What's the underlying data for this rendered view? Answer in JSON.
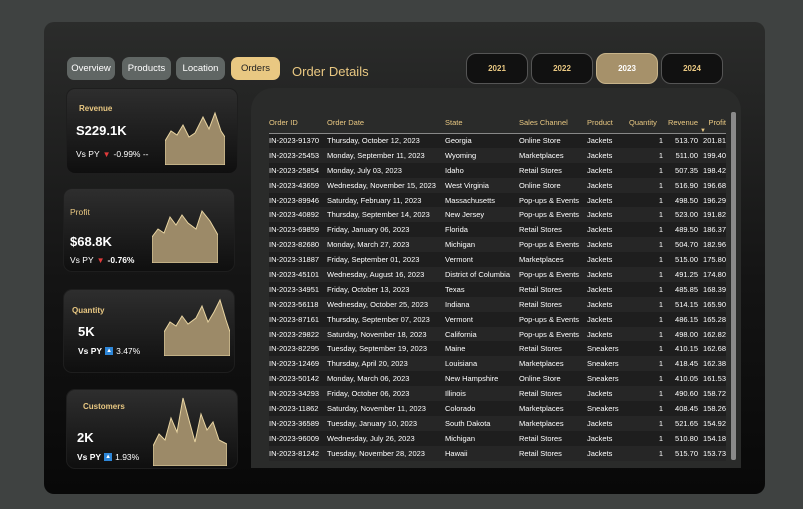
{
  "nav": {
    "tabs": [
      {
        "label": "Overview",
        "active": false
      },
      {
        "label": "Products",
        "active": false
      },
      {
        "label": "Location",
        "active": false
      },
      {
        "label": "Orders",
        "active": true
      }
    ]
  },
  "section_title": "Order Details",
  "years": [
    {
      "label": "2021",
      "active": false
    },
    {
      "label": "2022",
      "active": false
    },
    {
      "label": "2023",
      "active": true
    },
    {
      "label": "2024",
      "active": false
    }
  ],
  "kpis": {
    "revenue": {
      "label": "Revenue",
      "value": "S229.1K",
      "vs_label": "Vs PY",
      "change": "-0.99% --",
      "trend": "down"
    },
    "profit": {
      "label": "Profit",
      "value": "$68.8K",
      "vs_label": "Vs PY",
      "change": "-0.76%",
      "trend": "down"
    },
    "quantity": {
      "label": "Quantity",
      "value": "5K",
      "vs_label": "Vs PY",
      "change": "3.47%",
      "trend": "up"
    },
    "customers": {
      "label": "Customers",
      "value": "2K",
      "vs_label": "Vs PY",
      "change": "1.93%",
      "trend": "up"
    }
  },
  "colors": {
    "accent": "#e9c882",
    "down": "#e23b3b",
    "up": "#2d86d8",
    "spark_fill": "#9c8a68"
  },
  "table": {
    "columns": [
      "Order ID",
      "Order Date",
      "State",
      "Sales Channel",
      "Product",
      "Quantity",
      "Revenue",
      "Profit"
    ],
    "sort_column": "Profit",
    "rows": [
      [
        "IN-2023-91370",
        "Thursday, October 12, 2023",
        "Georgia",
        "Online Store",
        "Jackets",
        "1",
        "513.70",
        "201.81"
      ],
      [
        "IN-2023-25453",
        "Monday, September 11, 2023",
        "Wyoming",
        "Marketplaces",
        "Jackets",
        "1",
        "511.00",
        "199.40"
      ],
      [
        "IN-2023-25854",
        "Monday, July 03, 2023",
        "Idaho",
        "Retail Stores",
        "Jackets",
        "1",
        "507.35",
        "198.42"
      ],
      [
        "IN-2023-43659",
        "Wednesday, November 15, 2023",
        "West Virginia",
        "Online Store",
        "Jackets",
        "1",
        "516.90",
        "196.68"
      ],
      [
        "IN-2023-89946",
        "Saturday, February 11, 2023",
        "Massachusetts",
        "Pop-ups & Events",
        "Jackets",
        "1",
        "498.50",
        "196.29"
      ],
      [
        "IN-2023-40892",
        "Thursday, September 14, 2023",
        "New Jersey",
        "Pop-ups & Events",
        "Jackets",
        "1",
        "523.00",
        "191.82"
      ],
      [
        "IN-2023-69859",
        "Friday, January 06, 2023",
        "Florida",
        "Retail Stores",
        "Jackets",
        "1",
        "489.50",
        "186.37"
      ],
      [
        "IN-2023-82680",
        "Monday, March 27, 2023",
        "Michigan",
        "Pop-ups & Events",
        "Jackets",
        "1",
        "504.70",
        "182.96"
      ],
      [
        "IN-2023-31887",
        "Friday, September 01, 2023",
        "Vermont",
        "Marketplaces",
        "Jackets",
        "1",
        "515.00",
        "175.80"
      ],
      [
        "IN-2023-45101",
        "Wednesday, August 16, 2023",
        "District of Columbia",
        "Pop-ups & Events",
        "Jackets",
        "1",
        "491.25",
        "174.80"
      ],
      [
        "IN-2023-34951",
        "Friday, October 13, 2023",
        "Texas",
        "Retail Stores",
        "Jackets",
        "1",
        "485.85",
        "168.39"
      ],
      [
        "IN-2023-56118",
        "Wednesday, October 25, 2023",
        "Indiana",
        "Retail Stores",
        "Jackets",
        "1",
        "514.15",
        "165.90"
      ],
      [
        "IN-2023-87161",
        "Thursday, September 07, 2023",
        "Vermont",
        "Pop-ups & Events",
        "Jackets",
        "1",
        "486.15",
        "165.28"
      ],
      [
        "IN-2023-29822",
        "Saturday, November 18, 2023",
        "California",
        "Pop-ups & Events",
        "Jackets",
        "1",
        "498.00",
        "162.82"
      ],
      [
        "IN-2023-82295",
        "Tuesday, September 19, 2023",
        "Maine",
        "Retail Stores",
        "Sneakers",
        "1",
        "410.15",
        "162.68"
      ],
      [
        "IN-2023-12469",
        "Thursday, April 20, 2023",
        "Louisiana",
        "Marketplaces",
        "Sneakers",
        "1",
        "418.45",
        "162.38"
      ],
      [
        "IN-2023-50142",
        "Monday, March 06, 2023",
        "New Hampshire",
        "Online Store",
        "Sneakers",
        "1",
        "410.05",
        "161.53"
      ],
      [
        "IN-2023-34293",
        "Friday, October 06, 2023",
        "Illinois",
        "Retail Stores",
        "Jackets",
        "1",
        "490.60",
        "158.72"
      ],
      [
        "IN-2023-11862",
        "Saturday, November 11, 2023",
        "Colorado",
        "Marketplaces",
        "Sneakers",
        "1",
        "408.45",
        "158.26"
      ],
      [
        "IN-2023-36589",
        "Tuesday, January 10, 2023",
        "South Dakota",
        "Marketplaces",
        "Jackets",
        "1",
        "521.65",
        "154.92"
      ],
      [
        "IN-2023-96009",
        "Wednesday, July 26, 2023",
        "Michigan",
        "Retail Stores",
        "Jackets",
        "1",
        "510.80",
        "154.18"
      ],
      [
        "IN-2023-81242",
        "Tuesday, November 28, 2023",
        "Hawaii",
        "Retail Stores",
        "Jackets",
        "1",
        "515.70",
        "153.73"
      ]
    ]
  }
}
